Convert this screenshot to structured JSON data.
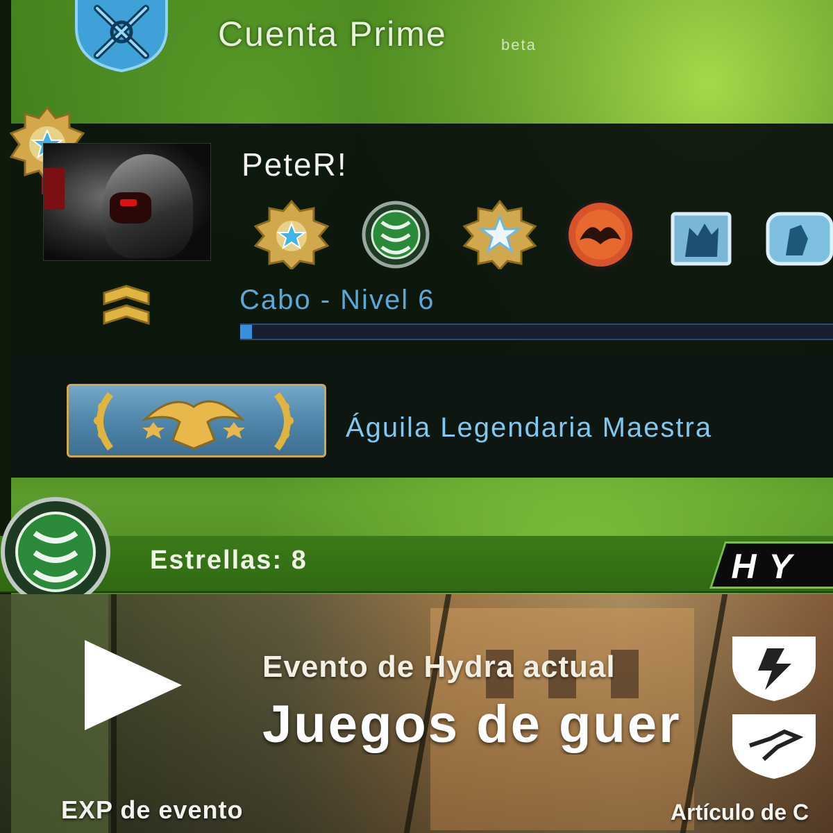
{
  "prime": {
    "title": "Cuenta Prime",
    "badge": "beta",
    "icon": "prime-shield-icon"
  },
  "profile": {
    "username": "PeteR!",
    "rank_label": "Cabo - Nivel 6",
    "xp_progress": 0.02,
    "skill_group": "Águila Legendaria Maestra",
    "medals": [
      "service-medal-icon",
      "hydra-coin-icon",
      "service-medal-star-icon",
      "operation-coin-icon",
      "pin-icon",
      "pin-icon"
    ]
  },
  "hydra": {
    "stars_label": "Estrellas: 8",
    "logo_text": "HY"
  },
  "event": {
    "title": "Evento de Hydra actual",
    "name": "Juegos de guer",
    "exp_label": "EXP de evento",
    "item_label": "Artículo de C"
  },
  "colors": {
    "accent_blue": "#5aa8d8",
    "hydra_green": "#7ac143",
    "gold": "#d1a84b"
  }
}
